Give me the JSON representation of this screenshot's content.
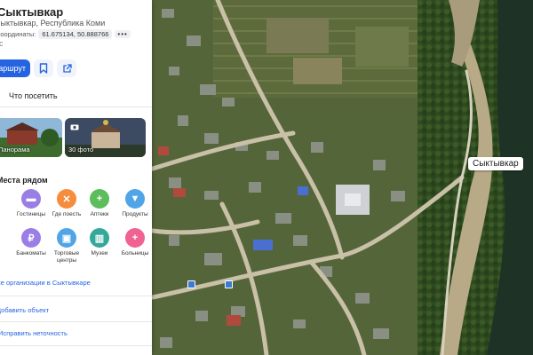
{
  "place": {
    "title": "Сыктывкар",
    "subtitle": "Сыктывкар, Республика Коми",
    "coords_label": "Координаты:",
    "coords": "61.675134, 50.888766",
    "coords_more": "•••",
    "stub": "с"
  },
  "actions": {
    "route": "Маршрут",
    "bookmark_icon": "bookmark-icon",
    "share_icon": "share-icon"
  },
  "visit_label": "Что посетить",
  "photos": {
    "panorama": "Панорама",
    "photos": "30 фото"
  },
  "nearby": {
    "title": "Места рядом",
    "categories": [
      {
        "label": "Кафе",
        "color": "#f7c322",
        "icon": "cafe-icon",
        "glyph": "☕"
      },
      {
        "label": "Гостиницы",
        "color": "#9a7ee6",
        "icon": "bed-icon",
        "glyph": "▬"
      },
      {
        "label": "Где поесть",
        "color": "#f58d3c",
        "icon": "cutlery-icon",
        "glyph": "✕"
      },
      {
        "label": "Аптеки",
        "color": "#5bbd5b",
        "icon": "pharmacy-icon",
        "glyph": "+"
      },
      {
        "label": "Продукты",
        "color": "#4fa5e8",
        "icon": "basket-icon",
        "glyph": "▼"
      },
      {
        "label": "Банки",
        "color": "#6f9be8",
        "icon": "bank-icon",
        "glyph": "●"
      },
      {
        "label": "Банкоматы",
        "color": "#9a7ee6",
        "icon": "ruble-icon",
        "glyph": "₽"
      },
      {
        "label": "Торговые центры",
        "color": "#4fa5e8",
        "icon": "shopping-bag-icon",
        "glyph": "▣"
      },
      {
        "label": "Музеи",
        "color": "#34a899",
        "icon": "museum-icon",
        "glyph": "▥"
      },
      {
        "label": "Больницы",
        "color": "#f06292",
        "icon": "hospital-icon",
        "glyph": "+"
      }
    ]
  },
  "links": {
    "all_orgs": "Все организации в Сыктывкаре",
    "add_object": "Добавить объект",
    "fix_error": "Исправить неточность"
  },
  "map": {
    "pin_label": "Сыктывкар",
    "pin_color": "#e8312f",
    "route_color": "#2563e0"
  }
}
